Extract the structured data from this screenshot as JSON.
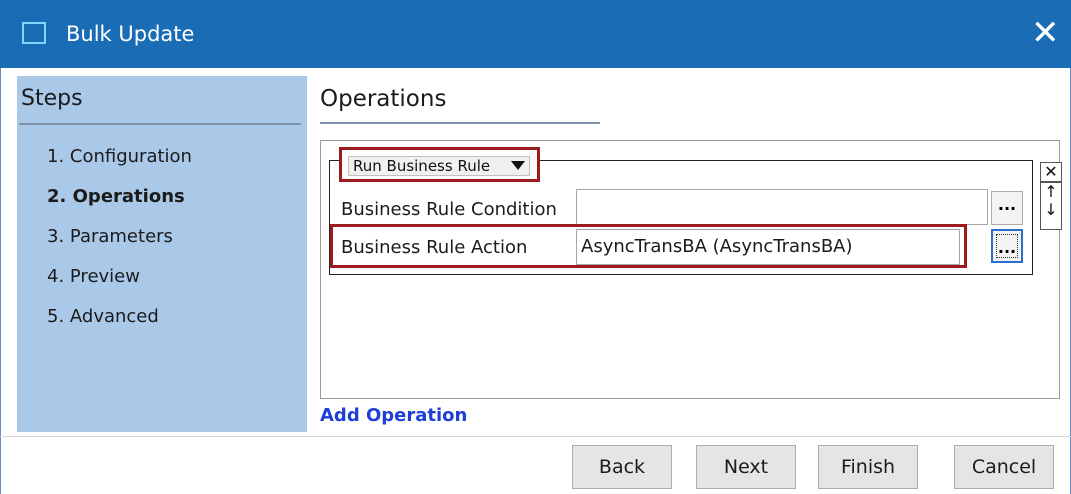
{
  "window": {
    "title": "Bulk Update",
    "icon": "window-icon",
    "close_label": "✕"
  },
  "steps": {
    "title": "Steps",
    "items": [
      {
        "label": "1. Configuration",
        "active": false
      },
      {
        "label": "2. Operations",
        "active": true
      },
      {
        "label": "3. Parameters",
        "active": false
      },
      {
        "label": "4. Preview",
        "active": false
      },
      {
        "label": "5. Advanced",
        "active": false
      }
    ]
  },
  "operations": {
    "title": "Operations",
    "operation_type": "Run Business Rule",
    "condition_label": "Business Rule Condition",
    "condition_value": "",
    "action_label": "Business Rule Action",
    "action_value": "AsyncTransBA (AsyncTransBA)",
    "browse_label": "...",
    "remove_icon": "close-box-icon",
    "move_up_label": "↑",
    "move_down_label": "↓",
    "add_operation_label": "Add Operation"
  },
  "footer": {
    "back": "Back",
    "next": "Next",
    "finish": "Finish",
    "cancel": "Cancel"
  },
  "colors": {
    "titlebar": "#1a6db5",
    "steps_bg": "#aac8e8",
    "highlight": "#9b1b1f",
    "link": "#1d3fd8"
  }
}
